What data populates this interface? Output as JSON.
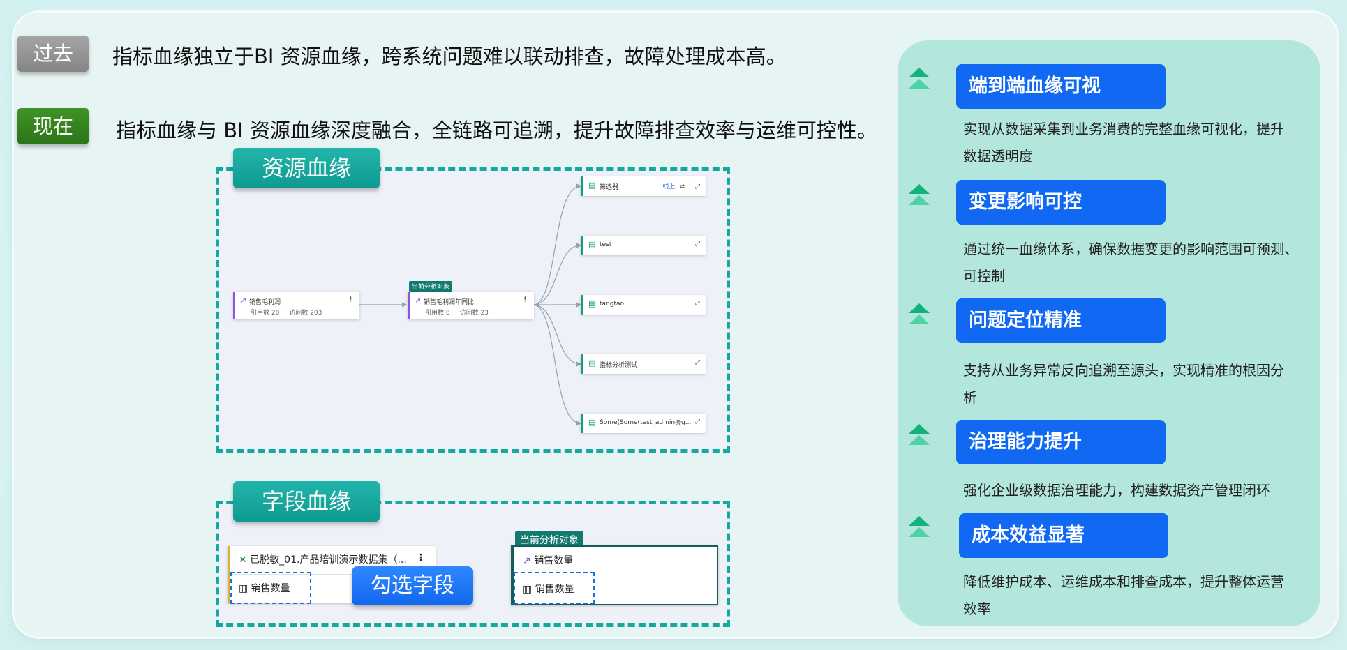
{
  "header": {
    "past_tag": "过去",
    "past_text": "指标血缘独立于BI 资源血缘，跨系统问题难以联动排查，故障处理成本高。",
    "now_tag": "现在",
    "now_text": "指标血缘与 BI 资源血缘深度融合，全链路可追溯，提升故障排查效率与运维可控性。"
  },
  "resource_lineage": {
    "title": "资源血缘",
    "current_tag": "当前分析对象",
    "source_node": {
      "name": "销售毛利润",
      "ref_label": "引用数 20",
      "visit_label": "访问数 203"
    },
    "current_node": {
      "name": "销售毛利润年同比",
      "ref_label": "引用数 8",
      "visit_label": "访问数 23"
    },
    "targets": [
      {
        "name": "筛选器",
        "status": "线上"
      },
      {
        "name": "test",
        "status": ""
      },
      {
        "name": "tangtao",
        "status": ""
      },
      {
        "name": "指标分析测试",
        "status": ""
      },
      {
        "name": "Some(Some(test_admin@g...",
        "status": ""
      }
    ]
  },
  "field_lineage": {
    "title": "字段血缘",
    "current_tag": "当前分析对象",
    "left_card": {
      "title": "已脱敏_01.产品培训演示数据集（...",
      "field": "销售数量"
    },
    "right_card": {
      "title": "销售数量",
      "field": "销售数量"
    },
    "select_button": "勾选字段"
  },
  "benefits": [
    {
      "title": "端到端血缘可视",
      "desc_line1": "实现从数据采集到业务消费的完整血缘可视化，提升",
      "desc_line2": "数据透明度"
    },
    {
      "title": "变更影响可控",
      "desc_line1": "通过统一血缘体系，确保数据变更的影响范围可预测、",
      "desc_line2": "可控制"
    },
    {
      "title": "问题定位精准",
      "desc_line1": "支持从业务异常反向追溯至源头，实现精准的根因分",
      "desc_line2": "析"
    },
    {
      "title": "治理能力提升",
      "desc_line1": "强化企业级数据治理能力，构建数据资产管理闭环",
      "desc_line2": ""
    },
    {
      "title": "成本效益显著",
      "desc_line1": "降低维护成本、运维成本和排查成本，提升整体运营",
      "desc_line2": "效率"
    }
  ],
  "colors": {
    "accent_teal": "#13a99f",
    "title_blue": "#1168f2",
    "panel_mint": "#b3e7dd"
  }
}
